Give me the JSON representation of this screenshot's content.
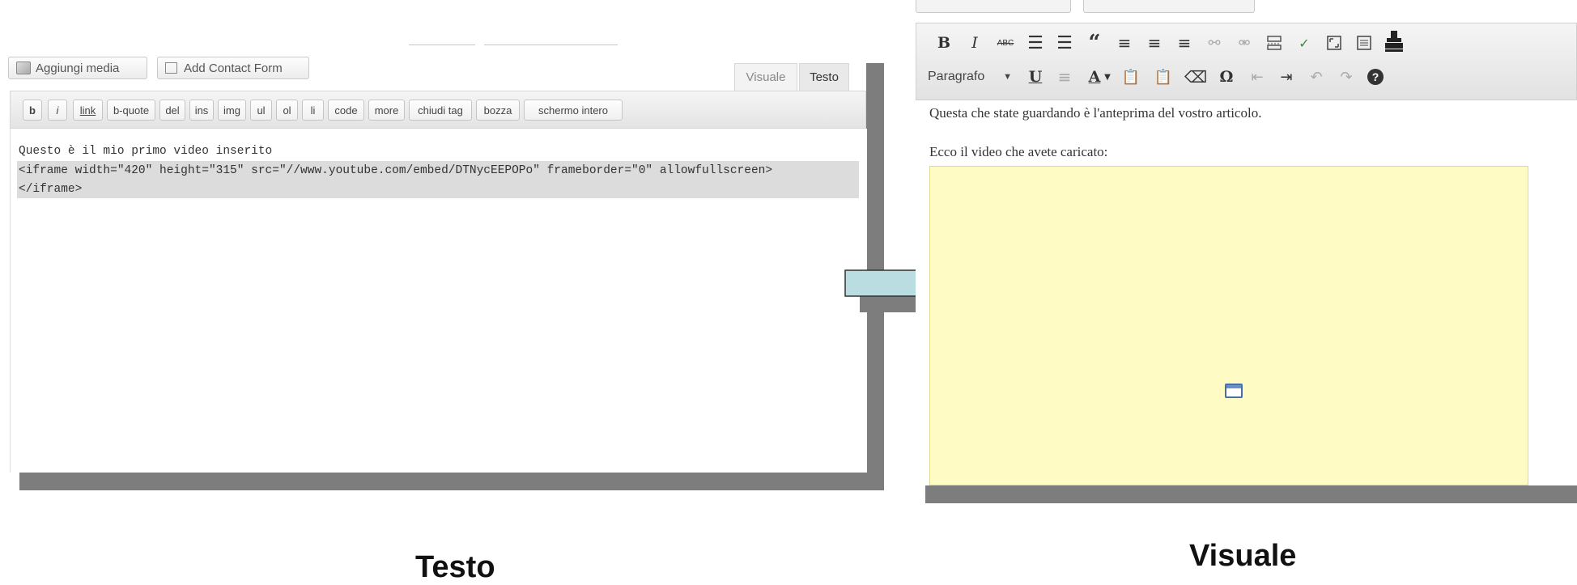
{
  "testo_panel": {
    "add_media_label": "Aggiungi media",
    "add_contact_form_label": "Add Contact Form",
    "tabs": {
      "visuale": "Visuale",
      "testo": "Testo"
    },
    "quicktags": [
      "b",
      "i",
      "link",
      "b-quote",
      "del",
      "ins",
      "img",
      "ul",
      "ol",
      "li",
      "code",
      "more",
      "chiudi tag",
      "bozza",
      "schermo intero"
    ],
    "code_lines": [
      "Questo è il mio primo video inserito",
      "<iframe width=\"420\" height=\"315\" src=\"//www.youtube.com/embed/DTNycEEPOPo\" frameborder=\"0\" allowfullscreen>",
      "</iframe>"
    ]
  },
  "visuale_panel": {
    "format_select": "Paragrafo",
    "icons_row1": [
      "bold-icon",
      "italic-icon",
      "strikethrough-icon",
      "bullet-list-icon",
      "numbered-list-icon",
      "blockquote-icon",
      "align-left-icon",
      "align-center-icon",
      "align-right-icon",
      "link-icon",
      "unlink-icon",
      "more-tag-icon",
      "spellcheck-icon",
      "fullscreen-icon",
      "kitchen-sink-icon",
      "stamp-icon"
    ],
    "icons_row2": [
      "underline-icon",
      "justify-icon",
      "text-color-icon",
      "paste-text-icon",
      "paste-word-icon",
      "clear-format-icon",
      "omega-icon",
      "outdent-icon",
      "indent-icon",
      "undo-icon",
      "redo-icon",
      "help-icon"
    ],
    "line1": "Questa che state guardando è l'anteprima del vostro articolo.",
    "line2": "Ecco il video che avete caricato:"
  },
  "captions": {
    "left": "Testo",
    "right": "Visuale"
  },
  "colors": {
    "arrow_fill": "#b9dde0",
    "shadow": "#7d7d7d",
    "video_placeholder": "#fffbc4"
  }
}
